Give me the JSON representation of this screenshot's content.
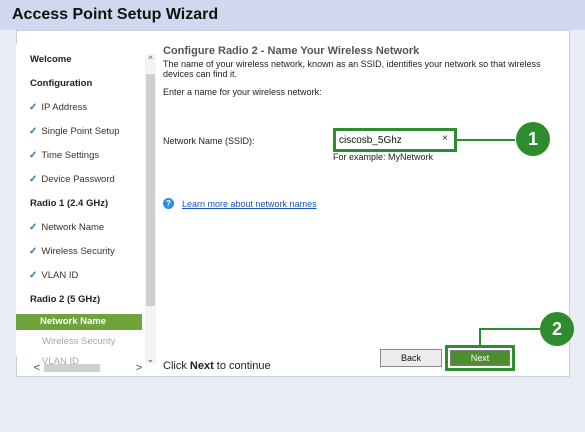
{
  "window": {
    "title": "Access Point Setup Wizard"
  },
  "sidebar": {
    "items": [
      {
        "label": "Welcome",
        "checked": false,
        "state": "heading"
      },
      {
        "label": "Configuration",
        "checked": false,
        "state": "heading"
      },
      {
        "label": "IP Address",
        "checked": true,
        "state": "done"
      },
      {
        "label": "Single Point Setup",
        "checked": true,
        "state": "done"
      },
      {
        "label": "Time Settings",
        "checked": true,
        "state": "done"
      },
      {
        "label": "Device Password",
        "checked": true,
        "state": "done"
      },
      {
        "label": "Radio 1 (2.4 GHz)",
        "checked": false,
        "state": "heading"
      },
      {
        "label": "Network Name",
        "checked": true,
        "state": "done"
      },
      {
        "label": "Wireless Security",
        "checked": true,
        "state": "done"
      },
      {
        "label": "VLAN ID",
        "checked": true,
        "state": "done"
      },
      {
        "label": "Radio 2 (5 GHz)",
        "checked": false,
        "state": "heading"
      },
      {
        "label": "Network Name",
        "checked": false,
        "state": "active"
      },
      {
        "label": "Wireless Security",
        "checked": false,
        "state": "disabled"
      },
      {
        "label": "VLAN ID",
        "checked": false,
        "state": "disabled"
      }
    ],
    "check_glyph": "✓"
  },
  "main": {
    "heading": "Configure Radio 2 - Name Your Wireless Network",
    "description": "The name of your wireless network, known as an SSID, identifies your network so that wireless devices can find it.",
    "prompt": "Enter a name for your wireless network:",
    "field_label": "Network Name (SSID):",
    "ssid_value": "ciscosb_5Ghz",
    "clear_glyph": "×",
    "example": "For example: MyNetwork",
    "help_glyph": "?",
    "learn_link": "Learn more about network names",
    "footer_prefix": "Click ",
    "footer_bold": "Next",
    "footer_suffix": " to continue"
  },
  "buttons": {
    "back": "Back",
    "next": "Next"
  },
  "callouts": {
    "first": "1",
    "second": "2"
  },
  "scroll": {
    "up": "^",
    "down": "⌄",
    "left": "<",
    "right": ">"
  },
  "colors": {
    "accent_green": "#2e8b2e",
    "active_item": "#6fa33b",
    "link": "#1c54b8",
    "check": "#2c6fd1"
  }
}
